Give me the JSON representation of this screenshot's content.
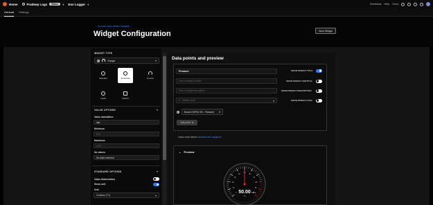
{
  "topbar": {
    "home_label": "Home",
    "project_label": "Pradeep Logs",
    "project_badge": "Maker",
    "device_label": "Env Logger",
    "right_items": [
      "Feedback",
      "Help",
      "Docs"
    ]
  },
  "tabs": [
    {
      "label": "General",
      "active": true
    },
    {
      "label": "Settings",
      "active": false
    }
  ],
  "header": {
    "back_link": "← Go back and cancel changes",
    "title": "Widget Configuration",
    "save_label": "Save Widget"
  },
  "left_panel": {
    "widget_type_title": "WIDGET TYPE",
    "widget_type_value": "Gauge",
    "types": [
      {
        "label": "Standard",
        "icon": "standard-gauge-icon",
        "selected": false
      },
      {
        "label": "Semicircle",
        "icon": "semicircle-gauge-icon",
        "selected": true
      },
      {
        "label": "Generic",
        "icon": "generic-gauge-icon",
        "selected": false
      },
      {
        "label": "Liquid",
        "icon": "liquid-gauge-icon",
        "selected": false
      },
      {
        "label": "Colorize",
        "icon": "colorize-gauge-icon",
        "selected": false
      }
    ],
    "value_options_title": "VALUE OPTIONS",
    "value_calc_label": "Value calculation",
    "value_calc_value": "last",
    "minimum_label": "Minimum",
    "minimum_placeholder": "800",
    "maximum_label": "Maximum",
    "maximum_placeholder": "1100",
    "no_values_label": "No values",
    "no_values_value": "No data received",
    "standard_options_title": "STANDARD OPTIONS",
    "value_abbrev_label": "Value abbreviation",
    "value_abbrev_on": false,
    "show_unit_label": "Show unit",
    "show_unit_on": true,
    "unit_label": "Unit",
    "unit_value": "Celsius (°C)"
  },
  "right_panel": {
    "title": "Data points and preview",
    "widget_title_value": "Pressure",
    "subtitle_placeholder": "Give a widget subtitle",
    "description_placeholder": "Give a widget description",
    "icon_placeholder": "Select icon",
    "options": [
      {
        "label": "SHOW WIDGET TITLE",
        "on": true
      },
      {
        "label": "SHOW WIDGET SUBTITLE",
        "on": false
      },
      {
        "label": "SHOW WIDGET DESCRIPTION",
        "on": false
      },
      {
        "label": "SHOW WIDGET ICON",
        "on": false
      }
    ],
    "data_source": "Bosch ESP32 CB - Pressure",
    "add_point_label": "Add point",
    "learn_prefix": "Learn more about",
    "learn_link": "functions and ranges",
    "preview_label": "Preview"
  },
  "gauge_preview": {
    "value": "50.00",
    "unit_suffix": "hPa",
    "sub_unit": "°C",
    "accent_color": "#e0232d",
    "tick_labels": [
      "0",
      "10",
      "20",
      "30",
      "40",
      "50",
      "60",
      "70",
      "80",
      "90",
      "100"
    ]
  },
  "colors": {
    "accent": "#2f7bff",
    "link": "#4a78ff",
    "brand": "#e85d2a"
  }
}
